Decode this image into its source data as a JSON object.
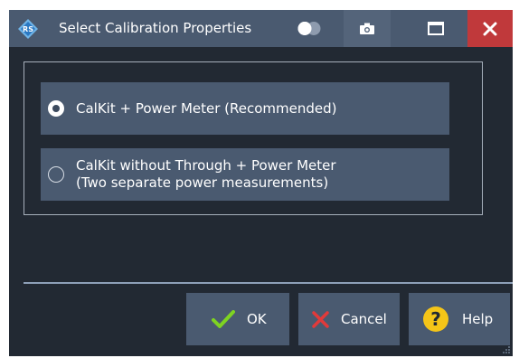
{
  "window": {
    "title": "Select Calibration Properties",
    "app_icon": "rs-logo-icon",
    "controls": [
      "toggle-icon",
      "camera-icon",
      "maximize-icon",
      "close-icon"
    ]
  },
  "options": [
    {
      "label": "CalKit + Power Meter (Recommended)",
      "selected": true
    },
    {
      "label_line1": "CalKit without Through + Power Meter",
      "label_line2": "(Two separate power measurements)",
      "selected": false
    }
  ],
  "buttons": {
    "ok": {
      "label": "OK",
      "icon": "check-icon"
    },
    "cancel": {
      "label": "Cancel",
      "icon": "x-icon"
    },
    "help": {
      "label": "Help",
      "icon": "question-icon"
    }
  },
  "colors": {
    "background": "#222933",
    "panel": "#4a5a70",
    "close": "#c0393b",
    "check": "#7ed321",
    "cancel_x": "#e23a3a",
    "help": "#f5c518"
  }
}
